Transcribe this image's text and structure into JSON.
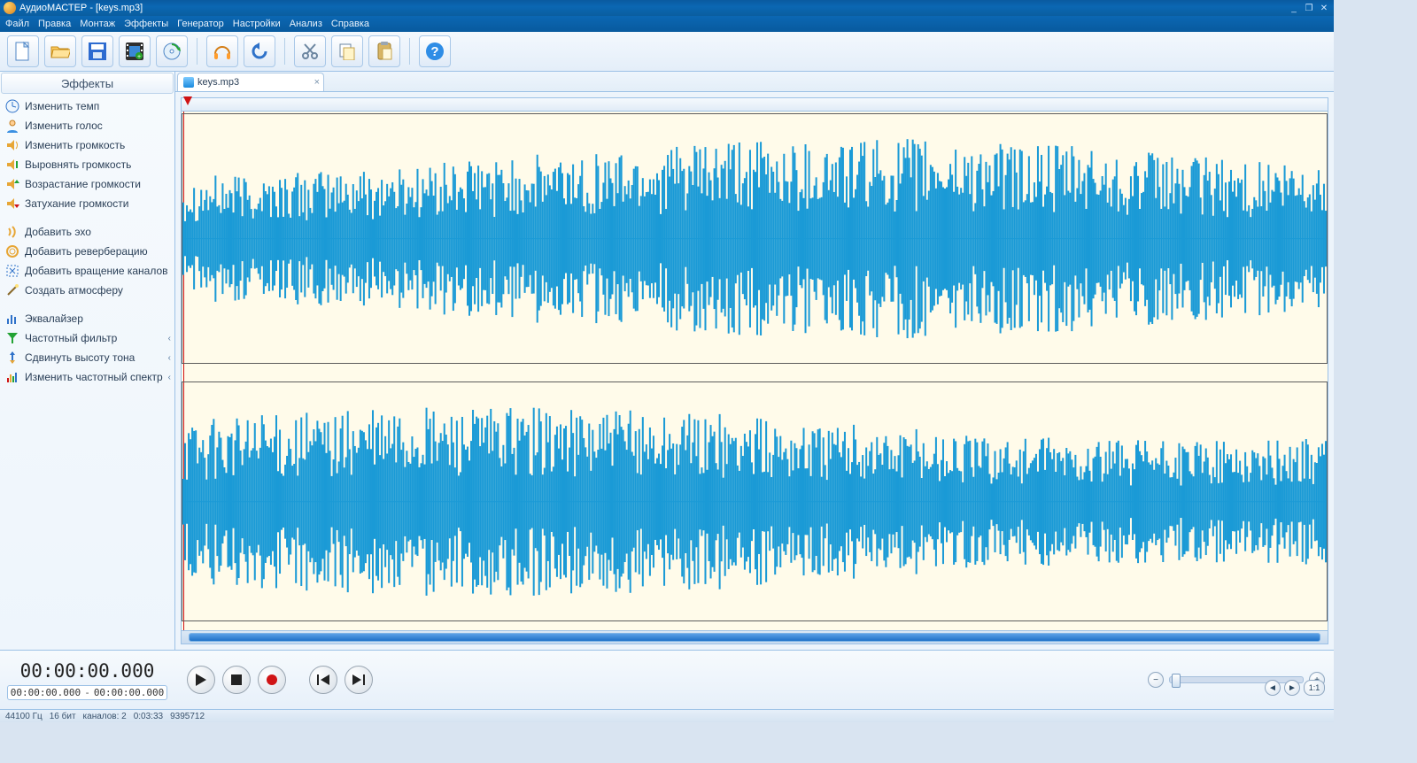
{
  "window": {
    "title": "АудиоМАСТЕР - [keys.mp3]"
  },
  "menu": {
    "items": [
      "Файл",
      "Правка",
      "Монтаж",
      "Эффекты",
      "Генератор",
      "Настройки",
      "Анализ",
      "Справка"
    ]
  },
  "toolbar": {
    "new": "new",
    "open": "open",
    "save": "save",
    "video": "video",
    "convert": "convert",
    "mix": "mix",
    "undo": "undo",
    "cut": "cut",
    "copy": "copy",
    "paste": "paste",
    "help": "help"
  },
  "sidebar": {
    "header": "Эффекты",
    "groups": {
      "g1": [
        "Изменить темп",
        "Изменить голос",
        "Изменить громкость",
        "Выровнять громкость",
        "Возрастание громкости",
        "Затухание громкости"
      ],
      "g2": [
        "Добавить эхо",
        "Добавить реверберацию",
        "Добавить вращение каналов",
        "Создать атмосферу"
      ],
      "g3": [
        "Эквалайзер",
        "Частотный фильтр",
        "Сдвинуть высоту тона",
        "Изменить частотный спектр"
      ]
    }
  },
  "tabs": {
    "active": {
      "label": "keys.mp3"
    }
  },
  "transport": {
    "current_time": "00:00:00.000",
    "sel_start": "00:00:00.000",
    "sel_end": "00:00:00.000",
    "sel_sep": "-"
  },
  "zoom": {
    "fit_label": "1:1"
  },
  "status": {
    "sample_rate": "44100 Гц",
    "bit_depth": "16 бит",
    "channels": "каналов: 2",
    "duration": "0:03:33",
    "samples": "9395712"
  }
}
